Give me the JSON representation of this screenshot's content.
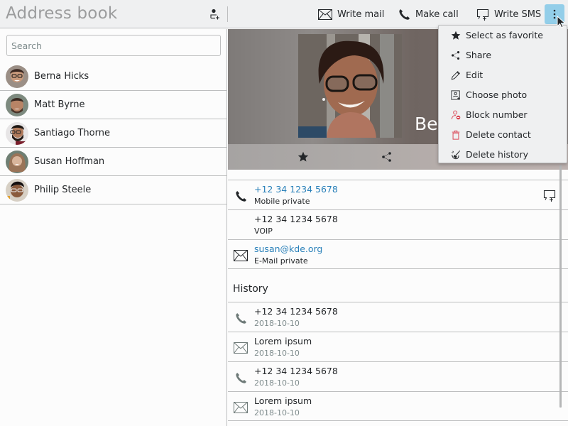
{
  "header": {
    "title": "Address book",
    "add_contact_icon": "add-contact-icon",
    "buttons": {
      "write_mail": "Write mail",
      "make_call": "Make call",
      "write_sms": "Write SMS"
    },
    "more_icon": "overflow-menu-icon",
    "accent_color": "#93cee9"
  },
  "sidebar": {
    "search_placeholder": "Search",
    "search_value": "",
    "contacts": [
      {
        "name": "Berna Hicks"
      },
      {
        "name": "Matt Byrne"
      },
      {
        "name": "Santiago Thorne"
      },
      {
        "name": "Susan Hoffman"
      },
      {
        "name": "Philip Steele"
      }
    ]
  },
  "contact": {
    "banner_name": "Berna Hicks",
    "banner_name_visible": "Ber",
    "actions": [
      "favorite",
      "share"
    ],
    "details": [
      {
        "icon": "phone-icon",
        "value": "+12 34 1234 5678",
        "label": "Mobile private",
        "link": true,
        "action_icon": "write-sms-icon"
      },
      {
        "icon": "",
        "value": "+12 34 1234 5678",
        "label": "VOIP",
        "link": false
      },
      {
        "icon": "mail-icon",
        "value": "susan@kde.org",
        "label": "E-Mail private",
        "link": true
      }
    ],
    "history_title": "History",
    "history": [
      {
        "icon": "phone-icon",
        "title": "+12 34 1234 5678",
        "date": "2018-10-10"
      },
      {
        "icon": "mail-icon",
        "title": "Lorem ipsum",
        "date": "2018-10-10"
      },
      {
        "icon": "phone-icon",
        "title": "+12 34 1234 5678",
        "date": "2018-10-10"
      },
      {
        "icon": "mail-icon",
        "title": "Lorem ipsum",
        "date": "2018-10-10"
      }
    ],
    "link_color": "#2980b9"
  },
  "menu": {
    "items": [
      {
        "label": "Select as favorite",
        "icon": "star-icon"
      },
      {
        "label": "Share",
        "icon": "share-icon"
      },
      {
        "label": "Edit",
        "icon": "pencil-icon"
      },
      {
        "label": "Choose photo",
        "icon": "choose-photo-icon"
      },
      {
        "label": "Block number",
        "icon": "block-user-icon",
        "danger": true
      },
      {
        "label": "Delete contact",
        "icon": "trash-icon",
        "danger": true
      },
      {
        "label": "Delete history",
        "icon": "clear-history-icon"
      }
    ],
    "danger_color": "#da4453"
  }
}
